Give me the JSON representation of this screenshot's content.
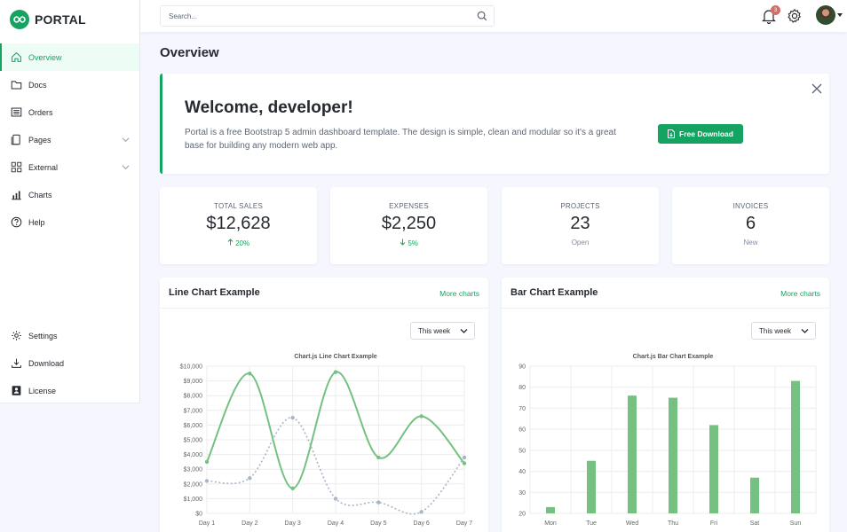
{
  "brand": {
    "name": "PORTAL"
  },
  "nav": {
    "items": [
      {
        "label": "Overview",
        "icon": "home-icon",
        "active": true
      },
      {
        "label": "Docs",
        "icon": "folder-icon"
      },
      {
        "label": "Orders",
        "icon": "list-icon"
      },
      {
        "label": "Pages",
        "icon": "files-icon"
      },
      {
        "label": "External",
        "icon": "grid-icon"
      },
      {
        "label": "Charts",
        "icon": "bar-chart-icon"
      },
      {
        "label": "Help",
        "icon": "question-icon"
      }
    ],
    "bottom": [
      {
        "label": "Settings",
        "icon": "gear-icon"
      },
      {
        "label": "Download",
        "icon": "download-icon"
      },
      {
        "label": "License",
        "icon": "license-icon"
      }
    ]
  },
  "header": {
    "search_placeholder": "Search...",
    "notification_count": "3"
  },
  "page": {
    "title": "Overview"
  },
  "welcome": {
    "title": "Welcome, developer!",
    "text": "Portal is a free Bootstrap 5 admin dashboard template. The design is simple, clean and modular so it's a great base for building any modern web app.",
    "button": "Free Download"
  },
  "stats": [
    {
      "label": "Total Sales",
      "value": "$12,628",
      "sub": "20%",
      "trend": "up"
    },
    {
      "label": "Expenses",
      "value": "$2,250",
      "sub": "5%",
      "trend": "down"
    },
    {
      "label": "Projects",
      "value": "23",
      "sub": "Open"
    },
    {
      "label": "Invoices",
      "value": "6",
      "sub": "New"
    }
  ],
  "colors": {
    "accent": "#15a362",
    "chart_green": "#75c181",
    "chart_gray": "#a9b5c9",
    "badge": "#d26d69"
  },
  "line_card": {
    "title": "Line Chart Example",
    "link": "More charts",
    "select": "This week"
  },
  "bar_card": {
    "title": "Bar Chart Example",
    "link": "More charts",
    "select": "This week"
  },
  "chart_data": [
    {
      "type": "line",
      "title": "Chart.js Line Chart Example",
      "categories": [
        "Day 1",
        "Day 2",
        "Day 3",
        "Day 4",
        "Day 5",
        "Day 6",
        "Day 7"
      ],
      "series": [
        {
          "values": [
            3500,
            9500,
            1700,
            9600,
            3800,
            6600,
            3400
          ]
        },
        {
          "values": [
            2200,
            2400,
            6500,
            1000,
            750,
            100,
            3800
          ]
        }
      ],
      "ylim": [
        0,
        10000
      ],
      "yticks": [
        "$0",
        "$1,000",
        "$2,000",
        "$3,000",
        "$4,000",
        "$5,000",
        "$6,000",
        "$7,000",
        "$8,000",
        "$9,000",
        "$10,000"
      ],
      "grid": true
    },
    {
      "type": "bar",
      "title": "Chart.js Bar Chart Example",
      "categories": [
        "Mon",
        "Tue",
        "Wed",
        "Thu",
        "Fri",
        "Sat",
        "Sun"
      ],
      "values": [
        23,
        45,
        76,
        75,
        62,
        37,
        83
      ],
      "ylim": [
        20,
        90
      ],
      "yticks": [
        "20",
        "30",
        "40",
        "50",
        "60",
        "70",
        "80",
        "90"
      ],
      "grid": true
    }
  ]
}
